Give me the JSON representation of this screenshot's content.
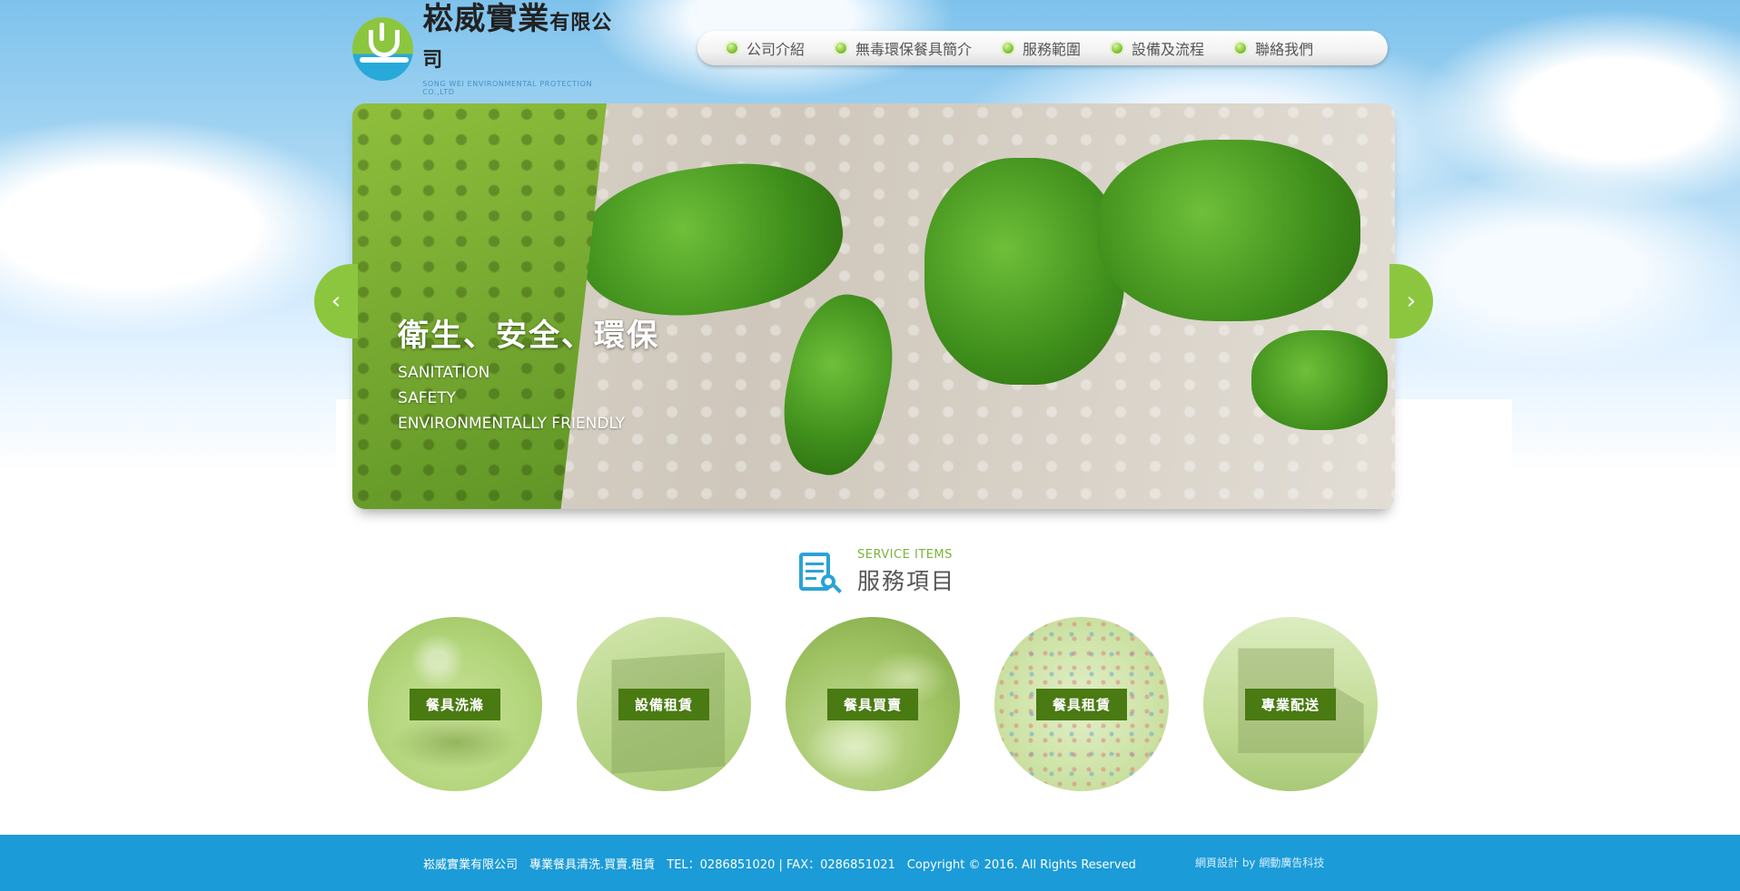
{
  "header": {
    "logo_title": "崧威實業",
    "logo_title_small": "有限公司",
    "logo_subtitle": "SONG WEI ENVIRONMENTAL PROTECTION CO.,LTD"
  },
  "nav": {
    "items": [
      "公司介紹",
      "無毒環保餐具簡介",
      "服務範圍",
      "設備及流程",
      "聯絡我們"
    ]
  },
  "banner": {
    "title": "衛生、安全、環保",
    "line1": "SANITATION",
    "line2": "SAFETY",
    "line3": "ENVIRONMENTALLY FRIENDLY",
    "prev_arrow": "‹",
    "next_arrow": "›"
  },
  "services": {
    "heading_en": "SERVICE ITEMS",
    "heading_zh": "服務項目",
    "items": [
      "餐具洗滌",
      "設備租賃",
      "餐具買賣",
      "餐具租賃",
      "專業配送"
    ]
  },
  "footer": {
    "info": "崧威實業有限公司　專業餐具清洗.買賣.租賃　TEL：0286851020 | FAX：0286851021　Copyright © 2016. All Rights Reserved",
    "credit": "網頁設計 by 網動廣告科技"
  },
  "colors": {
    "brand_green": "#8cc63f",
    "dark_green": "#4a7a12",
    "footer_blue": "#1b9bd7",
    "icon_blue": "#2aa3d6"
  }
}
